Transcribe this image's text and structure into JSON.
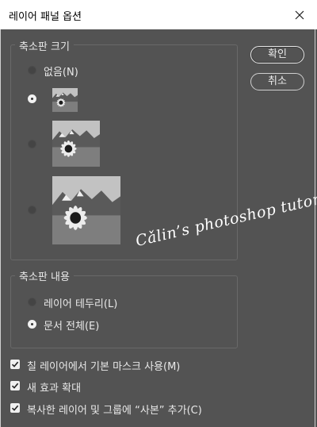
{
  "window": {
    "title": "레이어 패널 옵션"
  },
  "thumbnail_size": {
    "legend": "축소판 크기",
    "none_label": "없음(N)",
    "selected": "small"
  },
  "thumbnail_content": {
    "legend": "축소판 내용",
    "layer_bounds_label": "레이어 테두리(L)",
    "entire_document_label": "문서 전체(E)",
    "selected": "entire_document"
  },
  "buttons": {
    "ok": "확인",
    "cancel": "취소"
  },
  "options": [
    {
      "label": "칠 레이어에서 기본 마스크 사용(M)",
      "checked": true
    },
    {
      "label": "새 효과 확대",
      "checked": true
    },
    {
      "label": "복사한 레이어 및 그룹에 “사본” 추가(C)",
      "checked": true
    }
  ],
  "watermark": "Cǎlin’s photoshop tutorial"
}
